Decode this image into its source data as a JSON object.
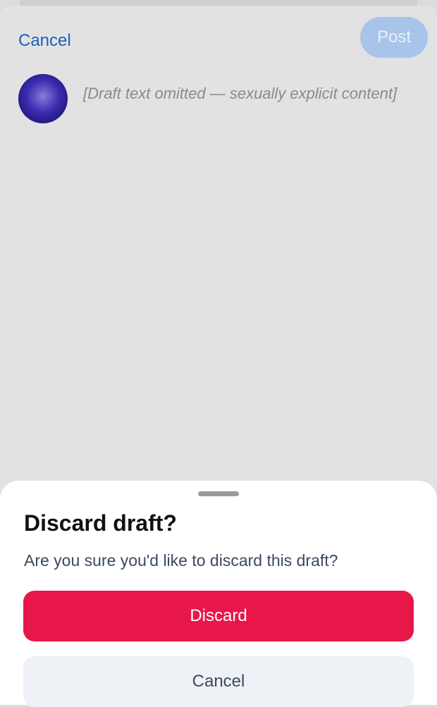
{
  "composer": {
    "cancel_label": "Cancel",
    "post_label": "Post",
    "draft_placeholder": "[Draft text omitted — sexually explicit content]"
  },
  "sheet": {
    "title": "Discard draft?",
    "message": "Are you sure you'd like to discard this draft?",
    "discard_label": "Discard",
    "cancel_label": "Cancel"
  },
  "colors": {
    "accent": "#1a5fc4",
    "danger": "#e8174a"
  }
}
